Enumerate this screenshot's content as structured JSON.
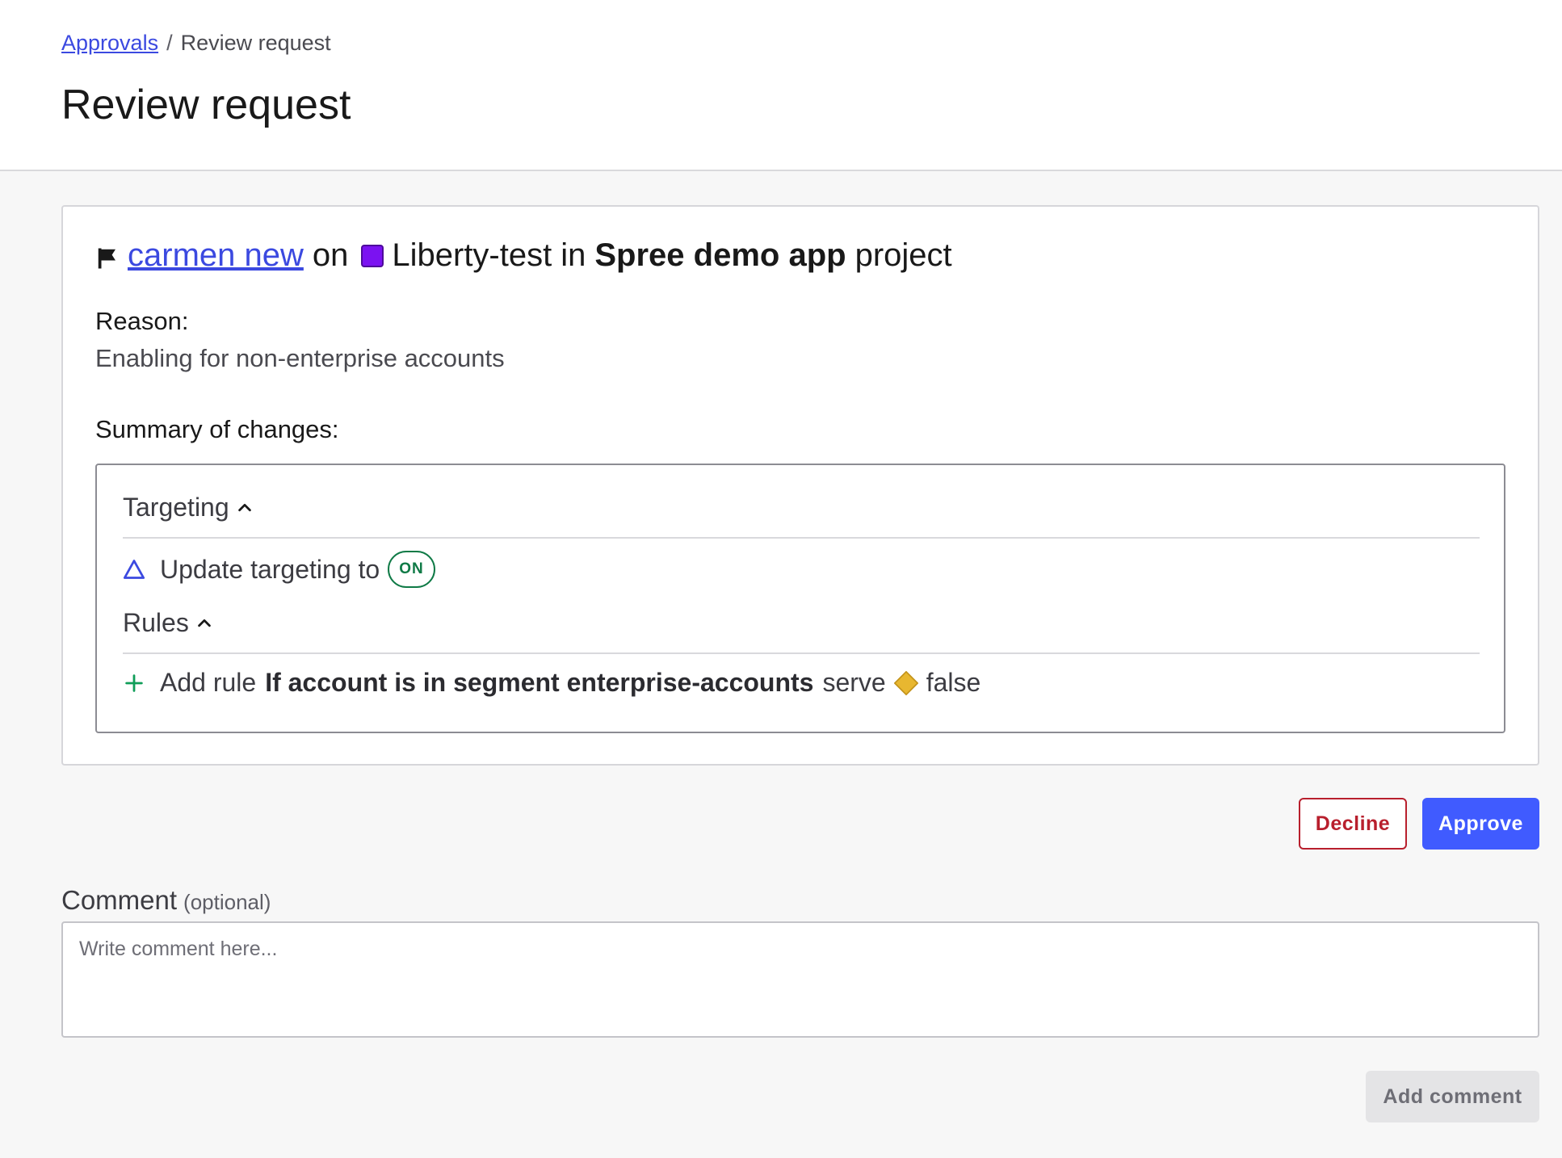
{
  "breadcrumb": {
    "parent": "Approvals",
    "separator": "/",
    "current": "Review request"
  },
  "page": {
    "title": "Review request"
  },
  "request": {
    "flag_name": "carmen new",
    "on_text": "on",
    "environment": "Liberty-test",
    "in_text": "in",
    "project": "Spree demo app",
    "project_suffix": "project",
    "environment_color": "#7b12f1"
  },
  "reason": {
    "label": "Reason:",
    "text": "Enabling for non-enterprise accounts"
  },
  "summary": {
    "label": "Summary of changes:",
    "targeting": {
      "heading": "Targeting",
      "change_text": "Update targeting to",
      "badge": "ON"
    },
    "rules": {
      "heading": "Rules",
      "add_text": "Add rule",
      "condition": "If account is in segment enterprise-accounts",
      "serve_text": "serve",
      "variation": "false",
      "variation_color": "#e8b730"
    }
  },
  "actions": {
    "decline": "Decline",
    "approve": "Approve"
  },
  "comment": {
    "label": "Comment",
    "optional": "(optional)",
    "placeholder": "Write comment here...",
    "value": "",
    "submit": "Add comment"
  },
  "colors": {
    "link": "#3b49e0",
    "primary": "#405bff",
    "danger": "#b81f2d",
    "success": "#0f7a46"
  }
}
